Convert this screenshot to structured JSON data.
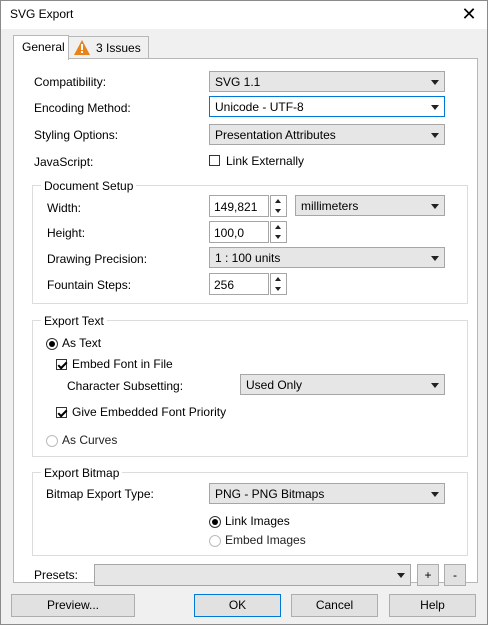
{
  "window": {
    "title": "SVG Export",
    "close_icon": "close-icon"
  },
  "tabs": [
    {
      "label": "General",
      "active": true
    },
    {
      "label": "3 Issues",
      "icon": "warning-icon",
      "icon_color": "#e8821a"
    }
  ],
  "general": {
    "compatibility": {
      "label": "Compatibility:",
      "value": "SVG 1.1"
    },
    "encoding": {
      "label": "Encoding Method:",
      "value": "Unicode - UTF-8"
    },
    "styling": {
      "label": "Styling Options:",
      "value": "Presentation Attributes"
    },
    "javascript": {
      "label": "JavaScript:",
      "checkbox_label": "Link Externally",
      "checked": false
    }
  },
  "document_setup": {
    "title": "Document Setup",
    "width": {
      "label": "Width:",
      "value": "149,821"
    },
    "units": "millimeters",
    "height": {
      "label": "Height:",
      "value": "100,0"
    },
    "precision": {
      "label": "Drawing Precision:",
      "value": "1 : 100 units"
    },
    "fountain": {
      "label": "Fountain Steps:",
      "value": "256"
    }
  },
  "export_text": {
    "title": "Export Text",
    "as_text": {
      "label": "As Text",
      "selected": true
    },
    "embed_font": {
      "label": "Embed Font in File",
      "checked": true
    },
    "char_subsetting": {
      "label": "Character Subsetting:",
      "value": "Used Only"
    },
    "give_priority": {
      "label": "Give Embedded Font Priority",
      "checked": true
    },
    "as_curves": {
      "label": "As Curves",
      "selected": false
    }
  },
  "export_bitmap": {
    "title": "Export Bitmap",
    "type": {
      "label": "Bitmap Export Type:",
      "value": "PNG - PNG Bitmaps"
    },
    "link_images": {
      "label": "Link Images",
      "selected": true
    },
    "embed_images": {
      "label": "Embed Images",
      "selected": false
    }
  },
  "presets": {
    "label": "Presets:",
    "value": "",
    "add": "+",
    "remove": "-"
  },
  "buttons": {
    "preview": "Preview...",
    "ok": "OK",
    "cancel": "Cancel",
    "help": "Help"
  }
}
